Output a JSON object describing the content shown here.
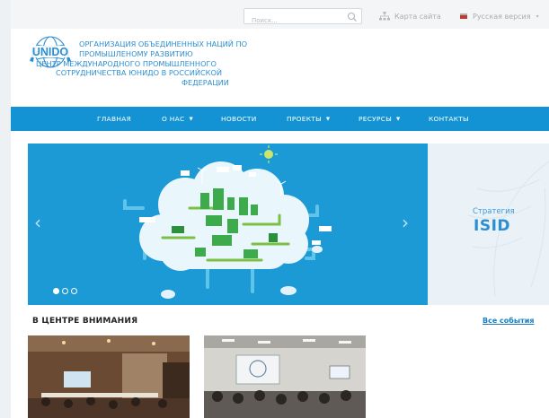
{
  "header": {
    "search_placeholder": "Поиск...",
    "sitemap_label": "Карта сайта",
    "lang_label": "Русская версия",
    "logo_text": "UNIDO",
    "org_title_lines": [
      "ОРГАНИЗАЦИЯ ОБЪЕДИНЕННЫХ НАЦИЙ ПО",
      "ПРОМЫШЛЕНОМУ РАЗВИТИЮ",
      "ЦЕНТР МЕЖДУНАРОДНОГО ПРОМЫШЛЕННОГО",
      "СОТРУДНИЧЕСТВА ЮНИДО В РОССИЙСКОЙ",
      "ФЕДЕРАЦИИ"
    ]
  },
  "nav": {
    "items": [
      {
        "label": "ГЛАВНАЯ",
        "dropdown": false
      },
      {
        "label": "О НАС",
        "dropdown": true
      },
      {
        "label": "НОВОСТИ",
        "dropdown": false
      },
      {
        "label": "ПРОЕКТЫ",
        "dropdown": true
      },
      {
        "label": "РЕСУРСЫ",
        "dropdown": true
      },
      {
        "label": "КОНТАКТЫ",
        "dropdown": false
      }
    ]
  },
  "hero": {
    "prev_arrow": "‹",
    "next_arrow": "›",
    "slide_count": 3,
    "active_slide": 0,
    "side_label": "Стратегия",
    "side_big": "ISID"
  },
  "section": {
    "title": "В ЦЕНТРЕ ВНИМАНИЯ",
    "all_events": "Все события"
  },
  "colors": {
    "brand_blue": "#1493d4",
    "hero_blue": "#1c9ad6",
    "text_blue": "#2e8fd0",
    "link_blue": "#1a7fc1"
  }
}
